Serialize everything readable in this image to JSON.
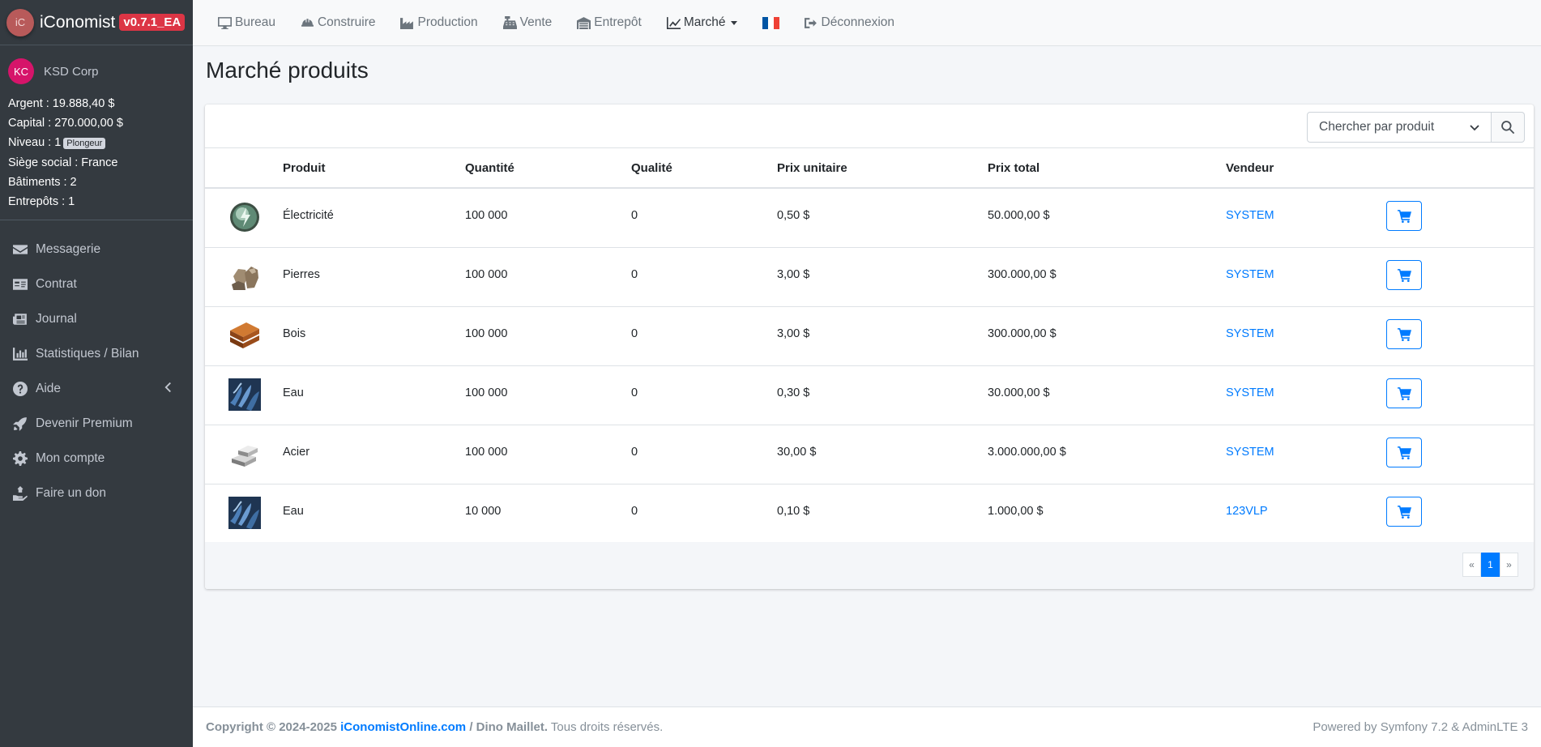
{
  "brand": {
    "logo_text": "iC",
    "name": "iConomist",
    "version": "v0.7.1_EA"
  },
  "user": {
    "initials": "KC",
    "company": "KSD Corp",
    "money": "Argent : 19.888,40 $",
    "capital": "Capital : 270.000,00 $",
    "level_label": "Niveau : 1",
    "level_badge": "Plongeur",
    "hq": "Siège social : France",
    "buildings": "Bâtiments : 2",
    "warehouses": "Entrepôts : 1"
  },
  "sidebar": {
    "items": [
      {
        "label": "Messagerie",
        "icon": "envelope-icon"
      },
      {
        "label": "Contrat",
        "icon": "id-card-icon"
      },
      {
        "label": "Journal",
        "icon": "newspaper-icon"
      },
      {
        "label": "Statistiques / Bilan",
        "icon": "bar-chart-icon"
      },
      {
        "label": "Aide",
        "icon": "question-circle-icon"
      },
      {
        "label": "Devenir Premium",
        "icon": "rocket-icon"
      },
      {
        "label": "Mon compte",
        "icon": "gear-icon"
      },
      {
        "label": "Faire un don",
        "icon": "hand-holding-icon"
      }
    ]
  },
  "topnav": {
    "items": [
      {
        "label": "Bureau",
        "icon": "desktop-icon"
      },
      {
        "label": "Construire",
        "icon": "hard-hat-icon"
      },
      {
        "label": "Production",
        "icon": "industry-icon"
      },
      {
        "label": "Vente",
        "icon": "cash-register-icon"
      },
      {
        "label": "Entrepôt",
        "icon": "warehouse-icon"
      },
      {
        "label": "Marché",
        "icon": "line-chart-icon"
      },
      {
        "label": "Déconnexion",
        "icon": "sign-out-icon"
      }
    ],
    "language_flag": "france-flag-icon"
  },
  "page": {
    "title": "Marché produits"
  },
  "search": {
    "placeholder": "Chercher par produit"
  },
  "table": {
    "headers": [
      "Produit",
      "Quantité",
      "Qualité",
      "Prix unitaire",
      "Prix total",
      "Vendeur"
    ],
    "rows": [
      {
        "icon": "electricity-icon",
        "product": "Électricité",
        "quantity": "100 000",
        "quality": "0",
        "unit_price": "0,50 $",
        "total_price": "50.000,00 $",
        "vendor": "SYSTEM"
      },
      {
        "icon": "stones-icon",
        "product": "Pierres",
        "quantity": "100 000",
        "quality": "0",
        "unit_price": "3,00 $",
        "total_price": "300.000,00 $",
        "vendor": "SYSTEM"
      },
      {
        "icon": "wood-icon",
        "product": "Bois",
        "quantity": "100 000",
        "quality": "0",
        "unit_price": "3,00 $",
        "total_price": "300.000,00 $",
        "vendor": "SYSTEM"
      },
      {
        "icon": "water-icon",
        "product": "Eau",
        "quantity": "100 000",
        "quality": "0",
        "unit_price": "0,30 $",
        "total_price": "30.000,00 $",
        "vendor": "SYSTEM"
      },
      {
        "icon": "steel-icon",
        "product": "Acier",
        "quantity": "100 000",
        "quality": "0",
        "unit_price": "30,00 $",
        "total_price": "3.000.000,00 $",
        "vendor": "SYSTEM"
      },
      {
        "icon": "water-icon",
        "product": "Eau",
        "quantity": "10 000",
        "quality": "0",
        "unit_price": "0,10 $",
        "total_price": "1.000,00 $",
        "vendor": "123VLP"
      }
    ]
  },
  "pagination": {
    "prev": "«",
    "current": "1",
    "next": "»"
  },
  "footer": {
    "copyright": "Copyright © 2024-2025",
    "site": "iConomistOnline.com",
    "author": "/ Dino Maillet.",
    "rights": "Tous droits réservés.",
    "powered": "Powered by Symfony 7.2 & AdminLTE 3"
  },
  "colors": {
    "accent": "#007bff",
    "sidebar": "#343a40",
    "badge": "#dc3545",
    "avatar": "#d6146a"
  }
}
